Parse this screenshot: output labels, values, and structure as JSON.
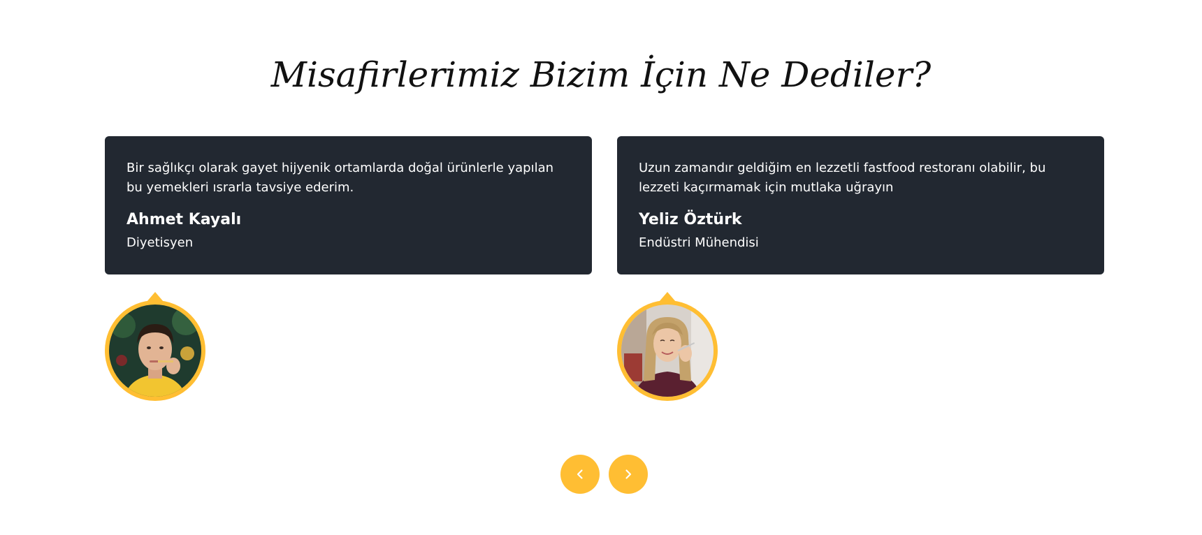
{
  "section": {
    "title": "Misafirlerimiz Bizim İçin Ne Dediler?"
  },
  "testimonials": [
    {
      "quote": "Bir sağlıkçı olarak gayet hijyenik ortamlarda doğal ürünlerle yapılan bu yemekleri ısrarla tavsiye ederim.",
      "name": "Ahmet Kayalı",
      "role": "Diyetisyen"
    },
    {
      "quote": "Uzun zamandır geldiğim en lezzetli fastfood restoranı olabilir, bu lezzeti kaçırmamak için mutlaka uğrayın",
      "name": "Yeliz Öztürk",
      "role": "Endüstri Mühendisi"
    }
  ],
  "carousel": {
    "prev_icon": "chevron-left-icon",
    "next_icon": "chevron-right-icon"
  },
  "colors": {
    "accent": "#ffbe33",
    "card_background": "#222831",
    "text_on_card": "#ffffff",
    "heading_text": "#111111"
  }
}
